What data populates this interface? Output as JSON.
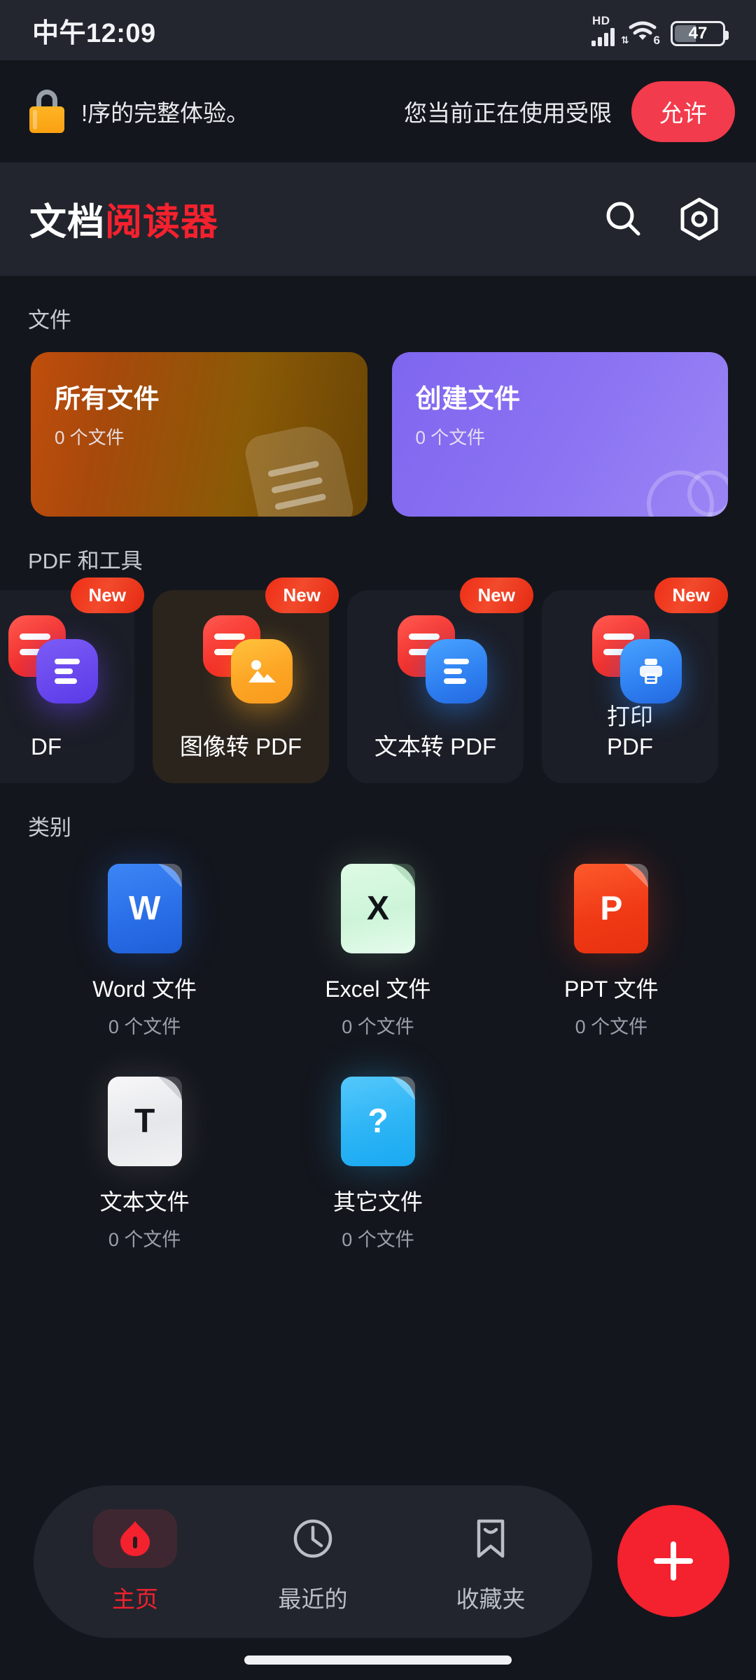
{
  "statusbar": {
    "time": "中午12:09",
    "network_label": "HD",
    "wifi_generation": "6",
    "battery_percent": "47",
    "icons": [
      "signal-icon",
      "wifi-icon",
      "battery-icon"
    ]
  },
  "permission_banner": {
    "icon": "lock-icon",
    "message_left": "!序的完整体验。",
    "message_right": "您当前正在使用受限",
    "allow_label": "允许",
    "allow_color": "#f23b4c"
  },
  "header": {
    "title_part1": "文档",
    "title_part2": "阅读器",
    "accent_color": "#f4212e",
    "search_icon": "search-icon",
    "settings_icon": "settings-hex-icon"
  },
  "files_section": {
    "label": "文件",
    "cards": [
      {
        "title": "所有文件",
        "count": "0 个文件",
        "color": "#b3480c",
        "watermark": "document-stack-watermark"
      },
      {
        "title": "创建文件",
        "count": "0 个文件",
        "color": "#7f66ef",
        "watermark": "circles-watermark"
      }
    ]
  },
  "tools_section": {
    "label": "PDF 和工具",
    "badge_label": "New",
    "cards": [
      {
        "label": "DF",
        "icon": "doc-to-pdf-icon",
        "badge": "New",
        "active": false,
        "clipped": true
      },
      {
        "label": "图像转 PDF",
        "icon": "image-to-pdf-icon",
        "badge": "New",
        "active": true,
        "clipped": false
      },
      {
        "label": "文本转 PDF",
        "icon": "text-to-pdf-icon",
        "badge": "New",
        "active": false,
        "clipped": false
      },
      {
        "label": "打印\nPDF",
        "icon": "print-pdf-icon",
        "badge": "New",
        "active": false,
        "clipped": false
      }
    ]
  },
  "categories_section": {
    "label": "类别",
    "items": [
      {
        "name": "Word 文件",
        "count": "0 个文件",
        "glyph": "W",
        "icon": "word-file-icon",
        "color": "#2a6fe8"
      },
      {
        "name": "Excel 文件",
        "count": "0 个文件",
        "glyph": "X",
        "icon": "excel-file-icon",
        "color": "#cdf4d8"
      },
      {
        "name": "PPT 文件",
        "count": "0 个文件",
        "glyph": "P",
        "icon": "ppt-file-icon",
        "color": "#f03a16"
      },
      {
        "name": "文本文件",
        "count": "0 个文件",
        "glyph": "T",
        "icon": "text-file-icon",
        "color": "#e6e7ea"
      },
      {
        "name": "其它文件",
        "count": "0 个文件",
        "glyph": "?",
        "icon": "other-file-icon",
        "color": "#2cb4f5"
      }
    ]
  },
  "bottom_nav": {
    "items": [
      {
        "label": "主页",
        "icon": "home-icon",
        "active": true
      },
      {
        "label": "最近的",
        "icon": "clock-icon",
        "active": false
      },
      {
        "label": "收藏夹",
        "icon": "bookmark-icon",
        "active": false
      }
    ],
    "fab_icon": "plus-icon",
    "fab_color": "#f4212e"
  }
}
